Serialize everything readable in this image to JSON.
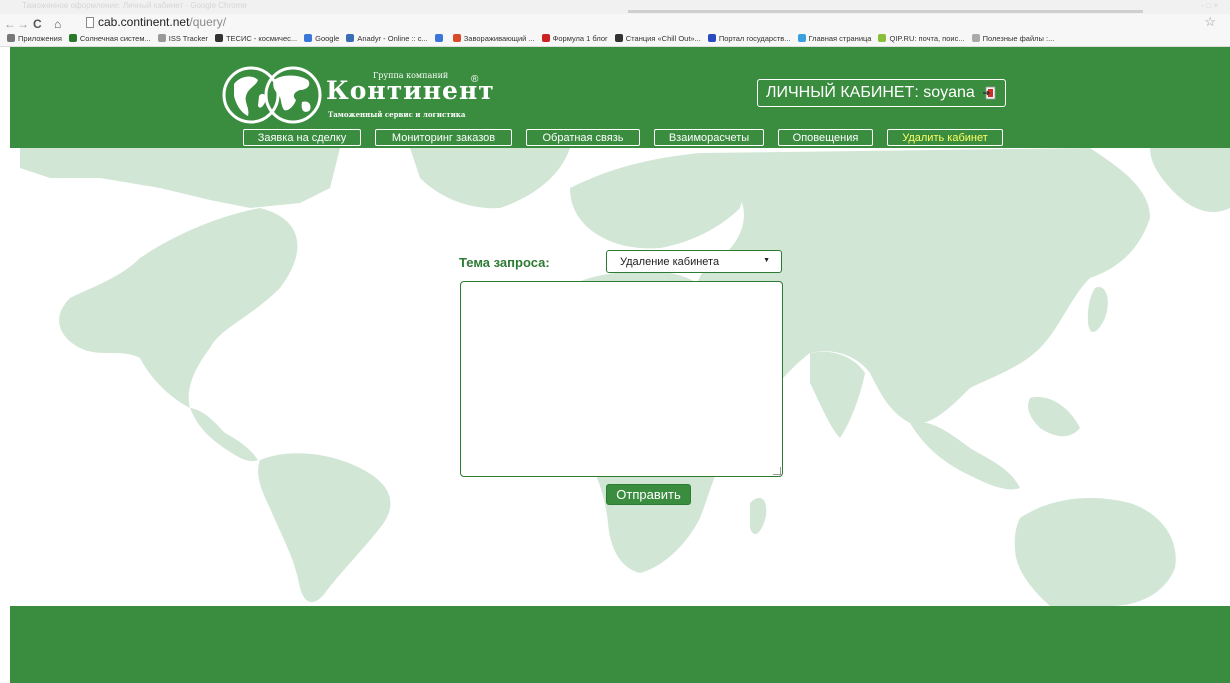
{
  "window": {
    "title": "Таможенное оформление: Личный кабинет - Google Chrome",
    "controls": "- □ ×"
  },
  "browser": {
    "url_host": "cab.continent.net",
    "url_path": "/query/",
    "bookmarks": [
      {
        "label": "Приложения",
        "icon": "apps-grid-icon",
        "color": "#777777"
      },
      {
        "label": "Солнечная систем...",
        "icon": "sun-site-icon",
        "color": "#2b7a2b"
      },
      {
        "label": "ISS Tracker",
        "icon": "satellite-icon",
        "color": "#999999"
      },
      {
        "label": "ТЕСИС - космичес...",
        "icon": "rocket-icon",
        "color": "#333333"
      },
      {
        "label": "Google",
        "icon": "google-icon",
        "color": "#3b77d9"
      },
      {
        "label": "Anadyr - Online :: c...",
        "icon": "game-icon",
        "color": "#3b6db5"
      },
      {
        "label": "",
        "icon": "google-icon",
        "color": "#3b77d9"
      },
      {
        "label": "Завораживающий ...",
        "icon": "media-icon",
        "color": "#d94a2b"
      },
      {
        "label": "Формула 1 блог",
        "icon": "f1-icon",
        "color": "#cc2222"
      },
      {
        "label": "Станция «Chill Out»...",
        "icon": "radio-icon",
        "color": "#333333"
      },
      {
        "label": "Портал государств...",
        "icon": "flag-icon",
        "color": "#2a4bbf"
      },
      {
        "label": "Главная страница",
        "icon": "portal-icon",
        "color": "#3aa0e0"
      },
      {
        "label": "QIP.RU: почта, поис...",
        "icon": "qip-icon",
        "color": "#88c03c"
      },
      {
        "label": "Полезные файлы :...",
        "icon": "page-icon",
        "color": "#aaaaaa"
      }
    ]
  },
  "header": {
    "logo_group": "Группа компаний",
    "logo_name": "Континент",
    "logo_sub": "Таможенный сервис и логистика",
    "logo_reg": "®",
    "cabinet_label": "ЛИЧНЫЙ КАБИНЕТ: soyana"
  },
  "menu": [
    {
      "label": "Заявка на сделку",
      "highlight": false
    },
    {
      "label": "Мониторинг заказов",
      "highlight": false
    },
    {
      "label": "Обратная связь",
      "highlight": false
    },
    {
      "label": "Взаиморасчеты",
      "highlight": false
    },
    {
      "label": "Оповещения",
      "highlight": false
    },
    {
      "label": "Удалить кабинет",
      "highlight": true
    }
  ],
  "form": {
    "topic_label": "Тема запроса:",
    "topic_value": "Удаление кабинета",
    "message_value": "",
    "submit_label": "Отправить"
  },
  "colors": {
    "brand_green": "#3a8c3f",
    "dark_green": "#2d7a32",
    "map_green": "#d2e6d6",
    "highlight_yellow": "#ffff66"
  }
}
